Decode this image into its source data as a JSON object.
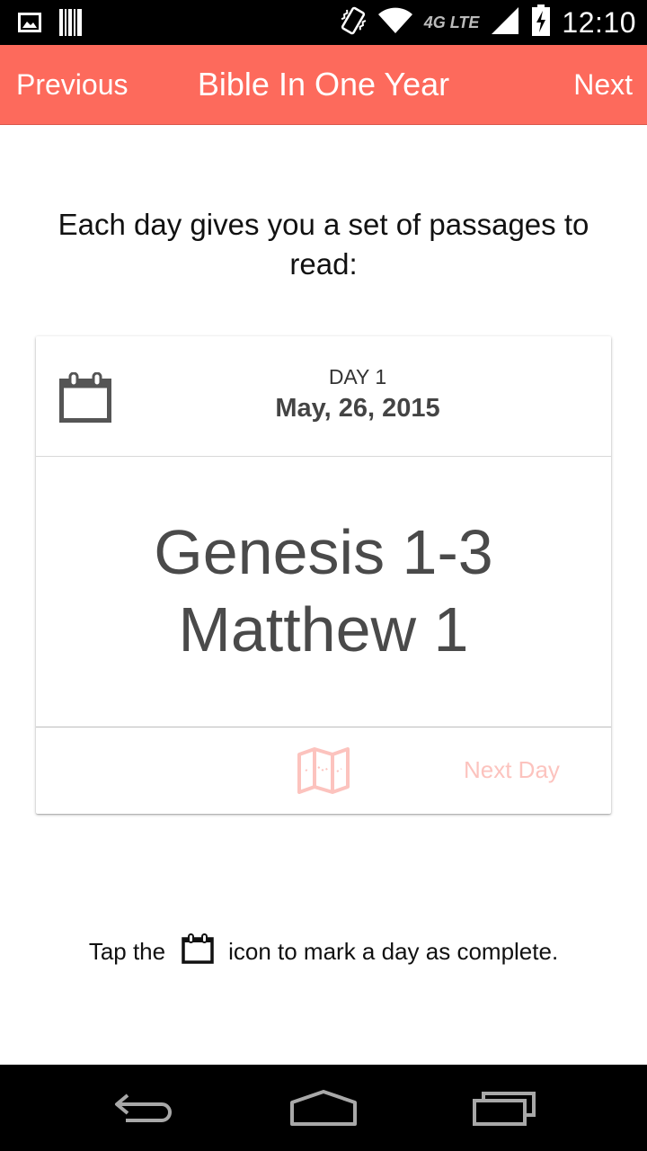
{
  "status_bar": {
    "network_label": "4G LTE",
    "time": "12:10",
    "icons": [
      "image-icon",
      "barcode-icon",
      "vibrate-icon",
      "wifi-icon",
      "signal-icon",
      "battery-charging-icon"
    ]
  },
  "app_bar": {
    "previous_label": "Previous",
    "title": "Bible In One Year",
    "next_label": "Next",
    "background": "#fd6a5c"
  },
  "intro_text": "Each day gives you a set of passages to read:",
  "card": {
    "day_label": "DAY 1",
    "date": "May, 26, 2015",
    "passages": [
      "Genesis 1-3",
      "Matthew 1"
    ],
    "next_day_label": "Next Day",
    "footer_icon": "map-icon"
  },
  "hint": {
    "before": "Tap the",
    "icon": "calendar-icon",
    "after": "icon to mark a day as complete."
  },
  "nav_bar": {
    "buttons": [
      "back-icon",
      "home-icon",
      "recent-apps-icon"
    ]
  }
}
